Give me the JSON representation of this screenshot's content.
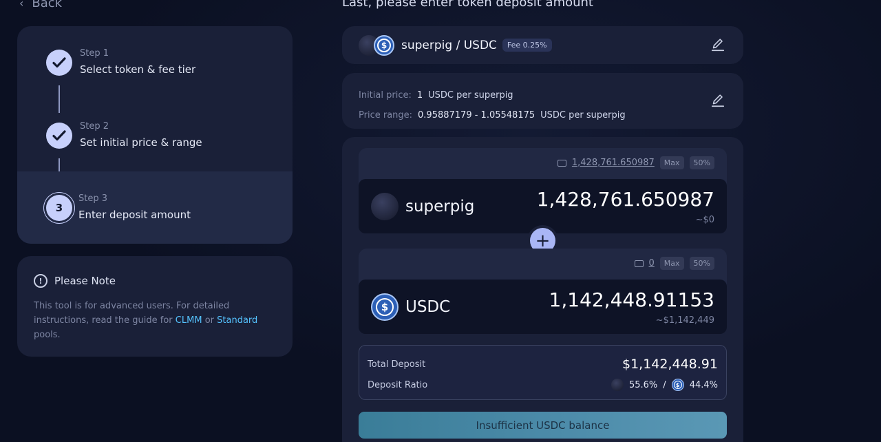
{
  "nav": {
    "back_label": "Back"
  },
  "steps": [
    {
      "sub": "Step 1",
      "title": "Select token & fee tier",
      "status": "done"
    },
    {
      "sub": "Step 2",
      "title": "Set initial price & range",
      "status": "done"
    },
    {
      "number": "3",
      "sub": "Step 3",
      "title": "Enter deposit amount",
      "status": "active"
    }
  ],
  "note": {
    "title": "Please Note",
    "body_prefix": "This tool is for advanced users. For detailed instructions, read the guide for",
    "link1": "CLMM",
    "or": "or",
    "link2": "Standard",
    "body_suffix": "pools."
  },
  "heading": "Last, please enter token deposit amount",
  "pair": {
    "name": "superpig / USDC",
    "fee": "Fee 0.25%"
  },
  "price": {
    "initial_label": "Initial price:",
    "initial_value": "1",
    "initial_unit": "USDC per superpig",
    "range_label": "Price range:",
    "range_value": "0.95887179 - 1.05548175",
    "range_unit": "USDC per superpig"
  },
  "token_a": {
    "name": "superpig",
    "balance": "1,428,761.650987",
    "amount": "1,428,761.650987",
    "usd": "~$0",
    "max": "Max",
    "half": "50%"
  },
  "token_b": {
    "name": "USDC",
    "balance": "0",
    "amount": "1,142,448.91153",
    "usd": "~$1,142,449",
    "max": "Max",
    "half": "50%"
  },
  "summary": {
    "total_label": "Total Deposit",
    "total_value": "$1,142,448.91",
    "ratio_label": "Deposit Ratio",
    "ratio_a": "55.6%",
    "ratio_sep": "/",
    "ratio_b": "44.4%"
  },
  "cta_label": "Insufficient USDC balance",
  "colors": {
    "accent": "#c7d0fb",
    "link": "#55c3ff",
    "card": "#1a2038",
    "background": "#0b1022"
  }
}
